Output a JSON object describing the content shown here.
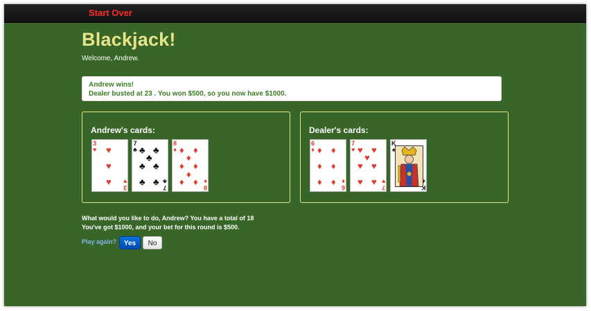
{
  "navbar": {
    "start_over": "Start Over"
  },
  "header": {
    "title": "Blackjack!",
    "welcome": "Welcome, Andrew."
  },
  "alert": {
    "line1": "Andrew wins!",
    "line2": "Dealer busted at 23 . You won $500, so you now have $1000."
  },
  "player": {
    "label": "Andrew's cards:",
    "cards": [
      {
        "rank": "3",
        "suit": "hearts",
        "symbol": "♥",
        "color": "#e03a2c"
      },
      {
        "rank": "7",
        "suit": "clubs",
        "symbol": "♣",
        "color": "#111111"
      },
      {
        "rank": "8",
        "suit": "diamonds",
        "symbol": "♦",
        "color": "#e03a2c"
      }
    ]
  },
  "dealer": {
    "label": "Dealer's cards:",
    "cards": [
      {
        "rank": "6",
        "suit": "diamonds",
        "symbol": "♦",
        "color": "#e03a2c"
      },
      {
        "rank": "7",
        "suit": "hearts",
        "symbol": "♥",
        "color": "#e03a2c"
      },
      {
        "rank": "K",
        "suit": "spades",
        "symbol": "♠",
        "color": "#111111"
      }
    ]
  },
  "status": {
    "line1": "What would you like to do, Andrew? You have a total of 18",
    "line2": "You've got $1000, and your bet for this round is $500."
  },
  "actions": {
    "play_again": "Play again?",
    "yes": "Yes",
    "no": "No"
  },
  "colors": {
    "felt": "#386629",
    "title": "#e8e48a",
    "brand": "#ff2a2a",
    "alert_text": "#3c7a23",
    "link": "#7fb7e8",
    "primary": "#0a72d8"
  }
}
